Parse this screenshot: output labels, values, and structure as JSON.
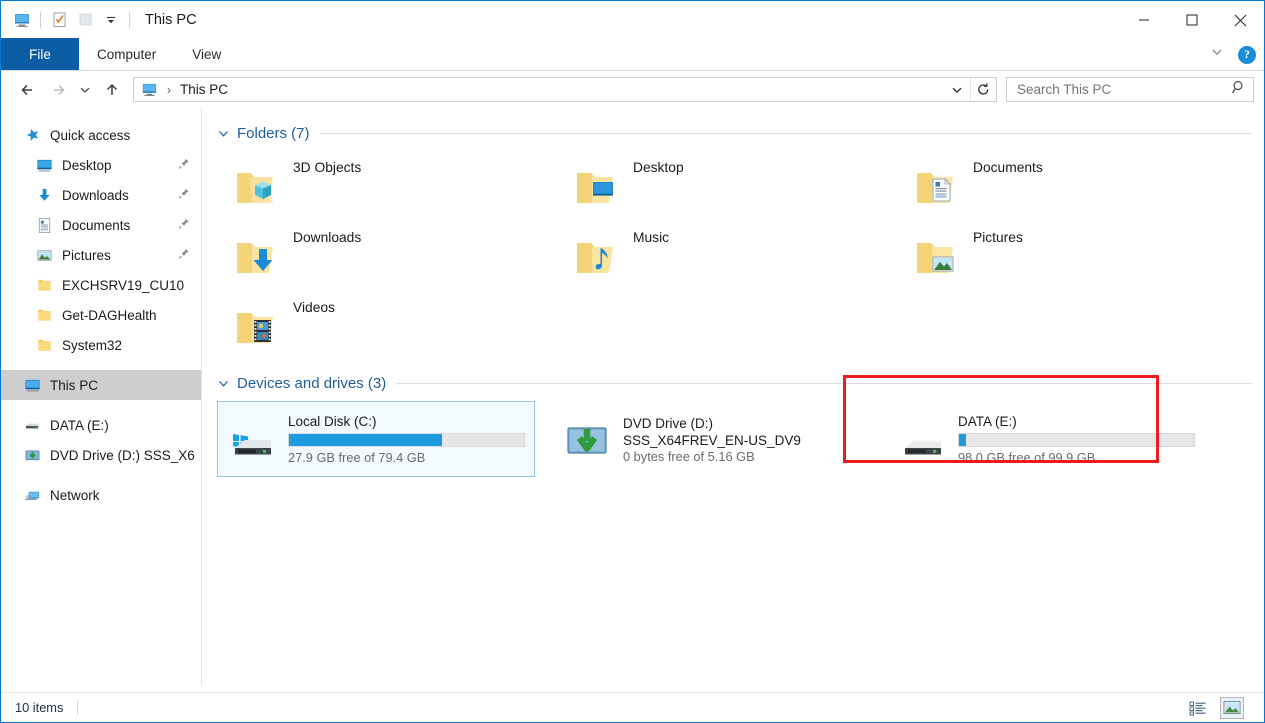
{
  "window": {
    "title": "This PC",
    "minimize_label": "Minimize",
    "maximize_label": "Maximize",
    "close_label": "Close"
  },
  "quick_access_toolbar": {
    "items": [
      {
        "name": "this-pc-icon",
        "label": "This PC"
      },
      {
        "name": "properties-icon",
        "label": "Properties"
      },
      {
        "name": "new-folder-icon",
        "label": "New folder"
      },
      {
        "name": "customize-dropdown-icon",
        "label": "Customize Quick Access Toolbar"
      }
    ]
  },
  "ribbon": {
    "tabs": [
      {
        "label": "File",
        "active": true
      },
      {
        "label": "Computer",
        "active": false
      },
      {
        "label": "View",
        "active": false
      }
    ],
    "collapse_label": "Minimize the Ribbon",
    "help_label": "?"
  },
  "navigation": {
    "back_label": "Back",
    "forward_label": "Forward",
    "recent_label": "Recent locations",
    "up_label": "Up",
    "breadcrumb": {
      "icon": "this-pc-icon",
      "path": "This PC",
      "separator": "›"
    },
    "dropdown_label": "Previous locations",
    "refresh_label": "Refresh"
  },
  "search": {
    "placeholder": "Search This PC",
    "value": "",
    "icon": "search-icon"
  },
  "sidebar": {
    "items": [
      {
        "label": "Quick access",
        "icon": "star-icon",
        "indent": 0,
        "pinned": false,
        "selected": false
      },
      {
        "label": "Desktop",
        "icon": "desktop-icon",
        "indent": 1,
        "pinned": true,
        "selected": false
      },
      {
        "label": "Downloads",
        "icon": "downloads-icon",
        "indent": 1,
        "pinned": true,
        "selected": false
      },
      {
        "label": "Documents",
        "icon": "documents-icon",
        "indent": 1,
        "pinned": true,
        "selected": false
      },
      {
        "label": "Pictures",
        "icon": "pictures-icon",
        "indent": 1,
        "pinned": true,
        "selected": false
      },
      {
        "label": "EXCHSRV19_CU10",
        "icon": "folder-icon",
        "indent": 1,
        "pinned": false,
        "selected": false
      },
      {
        "label": "Get-DAGHealth",
        "icon": "folder-icon",
        "indent": 1,
        "pinned": false,
        "selected": false
      },
      {
        "label": "System32",
        "icon": "folder-icon",
        "indent": 1,
        "pinned": false,
        "selected": false
      },
      {
        "label": "This PC",
        "icon": "this-pc-icon",
        "indent": 0,
        "pinned": false,
        "selected": true
      },
      {
        "label": "DATA (E:)",
        "icon": "hard-drive-icon",
        "indent": 0,
        "pinned": false,
        "selected": false
      },
      {
        "label": "DVD Drive (D:) SSS_X6",
        "icon": "dvd-drive-icon",
        "indent": 0,
        "pinned": false,
        "selected": false
      },
      {
        "label": "Network",
        "icon": "network-icon",
        "indent": 0,
        "pinned": false,
        "selected": false
      }
    ]
  },
  "main": {
    "folders_group": {
      "title": "Folders (7)",
      "chevron": "chevron-down-icon",
      "items": [
        {
          "name": "3D Objects",
          "icon": "folder-3d-objects-icon"
        },
        {
          "name": "Desktop",
          "icon": "folder-desktop-icon"
        },
        {
          "name": "Documents",
          "icon": "folder-documents-icon"
        },
        {
          "name": "Downloads",
          "icon": "folder-downloads-icon"
        },
        {
          "name": "Music",
          "icon": "folder-music-icon"
        },
        {
          "name": "Pictures",
          "icon": "folder-pictures-icon"
        },
        {
          "name": "Videos",
          "icon": "folder-videos-icon"
        }
      ]
    },
    "drives_group": {
      "title": "Devices and drives (3)",
      "chevron": "chevron-down-icon",
      "items": [
        {
          "name": "Local Disk (C:)",
          "subtitle": "",
          "icon": "windows-drive-icon",
          "free_text": "27.9 GB free of 79.4 GB",
          "used_percent": 65,
          "has_bar": true,
          "selected": true,
          "highlighted": false
        },
        {
          "name": "DVD Drive (D:)",
          "subtitle": "SSS_X64FREV_EN-US_DV9",
          "icon": "dvd-drive-icon",
          "free_text": "0 bytes free of 5.16 GB",
          "used_percent": 0,
          "has_bar": false,
          "selected": false,
          "highlighted": false
        },
        {
          "name": "DATA (E:)",
          "subtitle": "",
          "icon": "hard-drive-icon",
          "free_text": "98.0 GB free of 99.9 GB",
          "used_percent": 2,
          "has_bar": true,
          "selected": false,
          "highlighted": true
        }
      ]
    }
  },
  "statusbar": {
    "item_count": "10 items",
    "details_view_label": "Details view",
    "large_icons_view_label": "Large icons view"
  },
  "colors": {
    "accent": "#0078d7",
    "file_tab": "#0c5ca3",
    "group_title": "#1f5fa0",
    "bar_fill": "#1d9bde",
    "highlight": "#ee1c1c",
    "selection": "#cfcfcf"
  }
}
